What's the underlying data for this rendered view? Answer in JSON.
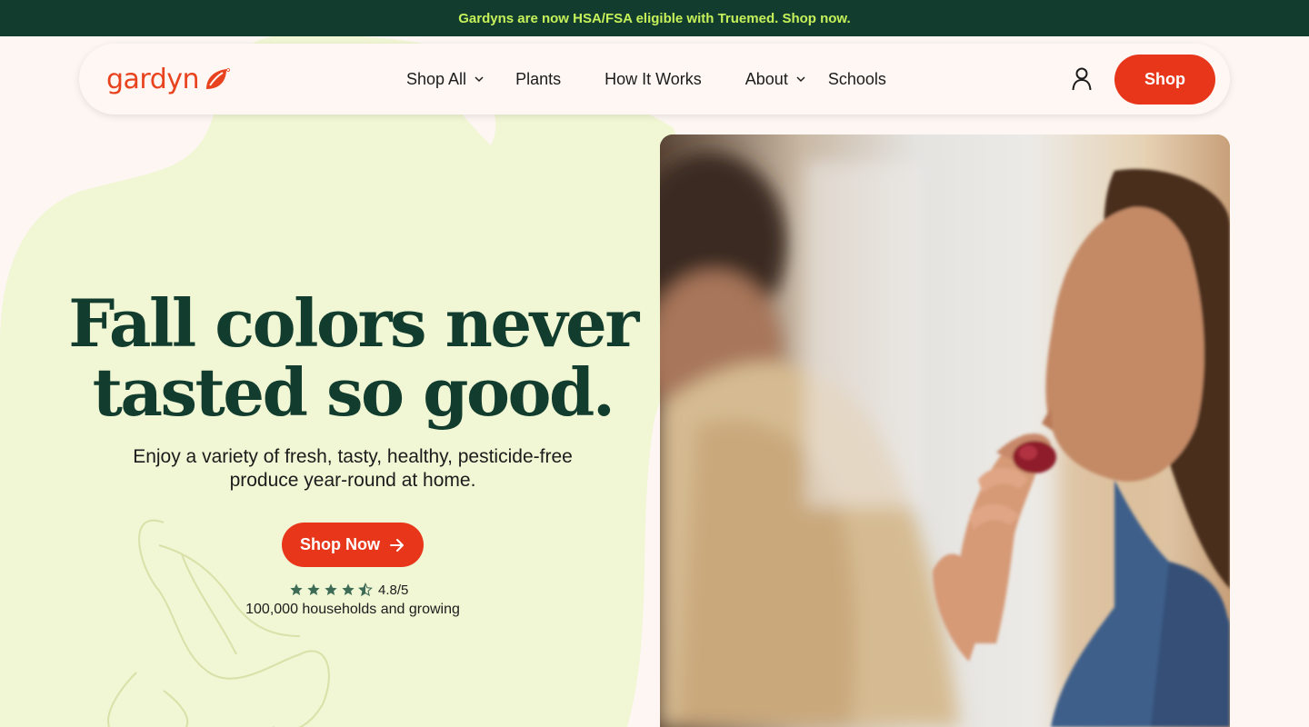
{
  "announcement": {
    "text": "Gardyns are now HSA/FSA eligible with Truemed. Shop now."
  },
  "nav": {
    "logo_text": "gardyn",
    "links": [
      {
        "label": "Shop All",
        "has_dropdown": true
      },
      {
        "label": "Plants",
        "has_dropdown": false
      },
      {
        "label": "How It Works",
        "has_dropdown": false
      },
      {
        "label": "About",
        "has_dropdown": true
      },
      {
        "label": "Schools",
        "has_dropdown": false
      }
    ],
    "shop_label": "Shop"
  },
  "hero": {
    "title_line1": "Fall colors never",
    "title_line2": "tasted so good.",
    "subtitle_line1": "Enjoy a variety of fresh, tasty, healthy, pesticide-free",
    "subtitle_line2": "produce year-round at home.",
    "cta_label": "Shop Now",
    "rating_text": "4.8/5",
    "rating_value": 4.8,
    "rating_max": 5,
    "households_text": "100,000 households and growing"
  },
  "colors": {
    "brand_red": "#e8361b",
    "dark_green": "#123d2e",
    "lime": "#c6f15a",
    "leaf_bg": "#f1f6d4",
    "page_bg": "#fdf6f2"
  }
}
